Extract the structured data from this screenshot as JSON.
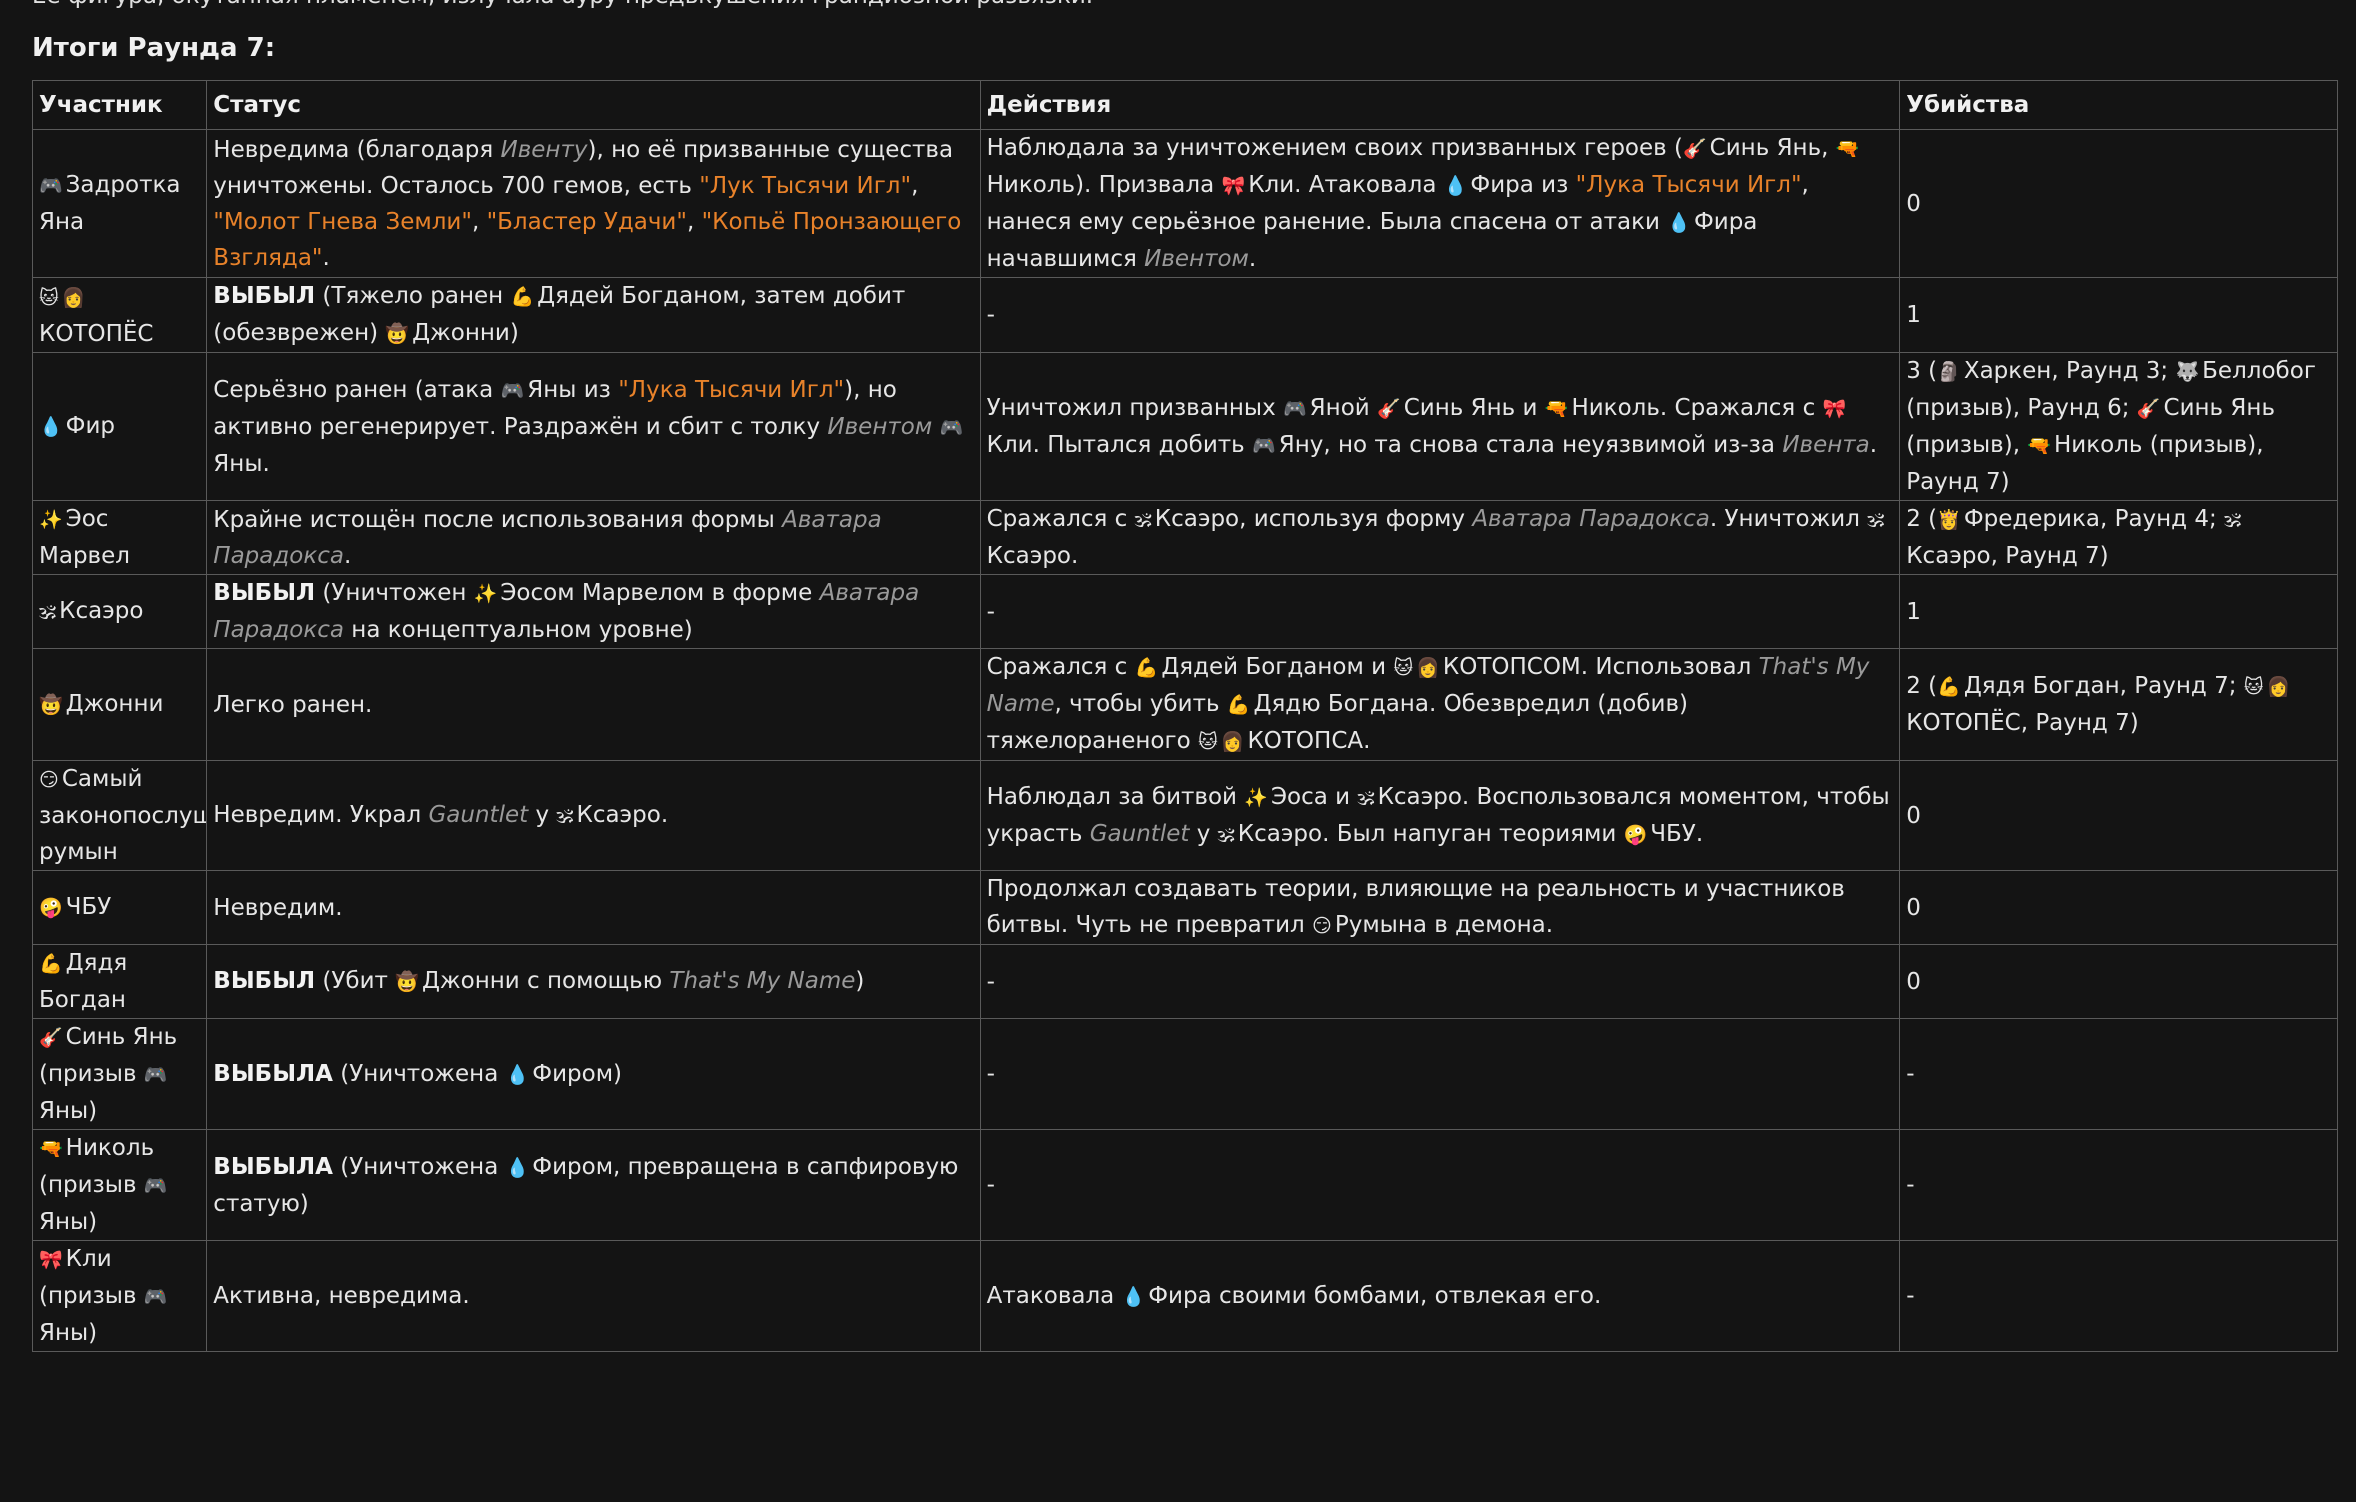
{
  "intro_text": "Её фигура, окутанная пламенем, излучала ауру предвкушения грандиозной развязки.",
  "title": "Итоги Раунда 7:",
  "columns": [
    "Участник",
    "Статус",
    "Действия",
    "Убийства"
  ],
  "rows": [
    {
      "participant": [
        {
          "icon": "🎮"
        },
        {
          "t": "Задротка Яна"
        }
      ],
      "status": [
        {
          "t": "Невредима (благодаря "
        },
        {
          "t": "Ивенту",
          "s": "it"
        },
        {
          "t": "), но её призванные существа уничтожены. Осталось 700 гемов, есть "
        },
        {
          "t": "\"Лук Тысячи Игл\"",
          "s": "lnk"
        },
        {
          "t": ", "
        },
        {
          "t": "\"Молот Гнева Земли\"",
          "s": "lnk"
        },
        {
          "t": ", "
        },
        {
          "t": "\"Бластер Удачи\"",
          "s": "lnk"
        },
        {
          "t": ", "
        },
        {
          "t": "\"Копьё Пронзающего Взгляда\"",
          "s": "lnk"
        },
        {
          "t": "."
        }
      ],
      "actions": [
        {
          "t": "Наблюдала за уничтожением своих призванных героев ("
        },
        {
          "icon": "🎸"
        },
        {
          "t": "Синь Янь, "
        },
        {
          "icon": "🔫"
        },
        {
          "t": "Николь). Призвала "
        },
        {
          "icon": "🎀"
        },
        {
          "t": "Кли. Атаковала "
        },
        {
          "icon": "💧"
        },
        {
          "t": "Фира из "
        },
        {
          "t": "\"Лука Тысячи Игл\"",
          "s": "lnk"
        },
        {
          "t": ", нанеся ему серьёзное ранение. Была спасена от атаки "
        },
        {
          "icon": "💧"
        },
        {
          "t": "Фира начавшимся "
        },
        {
          "t": "Ивентом",
          "s": "it"
        },
        {
          "t": "."
        }
      ],
      "kills": [
        {
          "t": "0"
        }
      ]
    },
    {
      "participant": [
        {
          "icon": "🐱"
        },
        {
          "icon": "👩"
        },
        {
          "t": "КОТОПЁС"
        }
      ],
      "status": [
        {
          "t": "ВЫБЫЛ",
          "s": "b"
        },
        {
          "t": " (Тяжело ранен "
        },
        {
          "icon": "💪"
        },
        {
          "t": "Дядей Богданом, затем добит (обезврежен) "
        },
        {
          "icon": "🤠"
        },
        {
          "t": "Джонни)"
        }
      ],
      "actions": [
        {
          "t": "-"
        }
      ],
      "kills": [
        {
          "t": "1"
        }
      ]
    },
    {
      "participant": [
        {
          "icon": "💧"
        },
        {
          "t": "Фир"
        }
      ],
      "status": [
        {
          "t": "Серьёзно ранен (атака "
        },
        {
          "icon": "🎮"
        },
        {
          "t": "Яны из "
        },
        {
          "t": "\"Лука Тысячи Игл\"",
          "s": "lnk"
        },
        {
          "t": "), но активно регенерирует. Раздражён и сбит с толку "
        },
        {
          "t": "Ивентом",
          "s": "it"
        },
        {
          "t": " "
        },
        {
          "icon": "🎮"
        },
        {
          "t": "Яны."
        }
      ],
      "actions": [
        {
          "t": "Уничтожил призванных "
        },
        {
          "icon": "🎮"
        },
        {
          "t": "Яной "
        },
        {
          "icon": "🎸"
        },
        {
          "t": "Синь Янь и "
        },
        {
          "icon": "🔫"
        },
        {
          "t": "Николь. Сражался с "
        },
        {
          "icon": "🎀"
        },
        {
          "t": "Кли. Пытался добить "
        },
        {
          "icon": "🎮"
        },
        {
          "t": "Яну, но та снова стала неуязвимой из-за "
        },
        {
          "t": "Ивента",
          "s": "it"
        },
        {
          "t": "."
        }
      ],
      "kills": [
        {
          "t": "3 ("
        },
        {
          "icon": "🗿"
        },
        {
          "t": "Харкен, Раунд 3; "
        },
        {
          "icon": "🐺"
        },
        {
          "t": "Беллобог (призыв), Раунд 6; "
        },
        {
          "icon": "🎸"
        },
        {
          "t": "Синь Янь (призыв), "
        },
        {
          "icon": "🔫"
        },
        {
          "t": "Николь (призыв), Раунд 7)"
        }
      ]
    },
    {
      "participant": [
        {
          "icon": "✨"
        },
        {
          "t": "Эос Марвел"
        }
      ],
      "status": [
        {
          "t": "Крайне истощён после использования формы "
        },
        {
          "t": "Аватара Парадокса",
          "s": "it"
        },
        {
          "t": "."
        }
      ],
      "actions": [
        {
          "t": "Сражался с "
        },
        {
          "icon": "🕉"
        },
        {
          "t": "Ксаэро, используя форму "
        },
        {
          "t": "Аватара Парадокса",
          "s": "it"
        },
        {
          "t": ". Уничтожил "
        },
        {
          "icon": "🕉"
        },
        {
          "t": "Ксаэро."
        }
      ],
      "kills": [
        {
          "t": "2 ("
        },
        {
          "icon": "👸"
        },
        {
          "t": "Фредерика, Раунд 4; "
        },
        {
          "icon": "🕉"
        },
        {
          "t": "Ксаэро, Раунд 7)"
        }
      ]
    },
    {
      "participant": [
        {
          "icon": "🕉"
        },
        {
          "t": "Ксаэро"
        }
      ],
      "status": [
        {
          "t": "ВЫБЫЛ",
          "s": "b"
        },
        {
          "t": " (Уничтожен "
        },
        {
          "icon": "✨"
        },
        {
          "t": "Эосом Марвелом в форме "
        },
        {
          "t": "Аватара Парадокса",
          "s": "it"
        },
        {
          "t": " на концептуальном уровне)"
        }
      ],
      "actions": [
        {
          "t": "-"
        }
      ],
      "kills": [
        {
          "t": "1"
        }
      ]
    },
    {
      "participant": [
        {
          "icon": "🤠"
        },
        {
          "t": "Джонни"
        }
      ],
      "status": [
        {
          "t": "Легко ранен."
        }
      ],
      "actions": [
        {
          "t": "Сражался с "
        },
        {
          "icon": "💪"
        },
        {
          "t": "Дядей Богданом и "
        },
        {
          "icon": "🐱"
        },
        {
          "icon": "👩"
        },
        {
          "t": "КОТОПСОМ. Использовал "
        },
        {
          "t": "That's My Name",
          "s": "it"
        },
        {
          "t": ", чтобы убить "
        },
        {
          "icon": "💪"
        },
        {
          "t": "Дядю Богдана. Обезвредил (добив) тяжелораненого "
        },
        {
          "icon": "🐱"
        },
        {
          "icon": "👩"
        },
        {
          "t": "КОТОПСА."
        }
      ],
      "kills": [
        {
          "t": "2 ("
        },
        {
          "icon": "💪"
        },
        {
          "t": "Дядя Богдан, Раунд 7; "
        },
        {
          "icon": "🐱"
        },
        {
          "icon": "👩"
        },
        {
          "t": "КОТОПЁС, Раунд 7)"
        }
      ]
    },
    {
      "participant": [
        {
          "icon": "😏"
        },
        {
          "t": "Самый законопослушный румын"
        }
      ],
      "status": [
        {
          "t": "Невредим. Украл "
        },
        {
          "t": "Gauntlet",
          "s": "it"
        },
        {
          "t": " у "
        },
        {
          "icon": "🕉"
        },
        {
          "t": "Ксаэро."
        }
      ],
      "actions": [
        {
          "t": "Наблюдал за битвой "
        },
        {
          "icon": "✨"
        },
        {
          "t": "Эоса и "
        },
        {
          "icon": "🕉"
        },
        {
          "t": "Ксаэро. Воспользовался моментом, чтобы украсть "
        },
        {
          "t": "Gauntlet",
          "s": "it"
        },
        {
          "t": " у "
        },
        {
          "icon": "🕉"
        },
        {
          "t": "Ксаэро. Был напуган теориями "
        },
        {
          "icon": "🤪"
        },
        {
          "t": "ЧБУ."
        }
      ],
      "kills": [
        {
          "t": "0"
        }
      ]
    },
    {
      "participant": [
        {
          "icon": "🤪"
        },
        {
          "t": "ЧБУ"
        }
      ],
      "status": [
        {
          "t": "Невредим."
        }
      ],
      "actions": [
        {
          "t": "Продолжал создавать теории, влияющие на реальность и участников битвы. Чуть не превратил "
        },
        {
          "icon": "😏"
        },
        {
          "t": "Румына в демона."
        }
      ],
      "kills": [
        {
          "t": "0"
        }
      ]
    },
    {
      "participant": [
        {
          "icon": "💪"
        },
        {
          "t": "Дядя Богдан"
        }
      ],
      "status": [
        {
          "t": "ВЫБЫЛ",
          "s": "b"
        },
        {
          "t": " (Убит "
        },
        {
          "icon": "🤠"
        },
        {
          "t": "Джонни с помощью "
        },
        {
          "t": "That's My Name",
          "s": "it"
        },
        {
          "t": ")"
        }
      ],
      "actions": [
        {
          "t": "-"
        }
      ],
      "kills": [
        {
          "t": "0"
        }
      ]
    },
    {
      "participant": [
        {
          "icon": "🎸"
        },
        {
          "t": "Синь Янь (призыв "
        },
        {
          "icon": "🎮"
        },
        {
          "t": "Яны)"
        }
      ],
      "status": [
        {
          "t": "ВЫБЫЛА",
          "s": "b"
        },
        {
          "t": " (Уничтожена "
        },
        {
          "icon": "💧"
        },
        {
          "t": "Фиром)"
        }
      ],
      "actions": [
        {
          "t": "-"
        }
      ],
      "kills": [
        {
          "t": "-"
        }
      ]
    },
    {
      "participant": [
        {
          "icon": "🔫"
        },
        {
          "t": "Николь (призыв "
        },
        {
          "icon": "🎮"
        },
        {
          "t": "Яны)"
        }
      ],
      "status": [
        {
          "t": "ВЫБЫЛА",
          "s": "b"
        },
        {
          "t": " (Уничтожена "
        },
        {
          "icon": "💧"
        },
        {
          "t": "Фиром, превращена в сапфировую статую)"
        }
      ],
      "actions": [
        {
          "t": "-"
        }
      ],
      "kills": [
        {
          "t": "-"
        }
      ]
    },
    {
      "participant": [
        {
          "icon": "🎀"
        },
        {
          "t": "Кли (призыв "
        },
        {
          "icon": "🎮"
        },
        {
          "t": "Яны)"
        }
      ],
      "status": [
        {
          "t": "Активна, невредима."
        }
      ],
      "actions": [
        {
          "t": "Атаковала "
        },
        {
          "icon": "💧"
        },
        {
          "t": "Фира своими бомбами, отвлекая его."
        }
      ],
      "kills": [
        {
          "t": "-"
        }
      ]
    }
  ]
}
